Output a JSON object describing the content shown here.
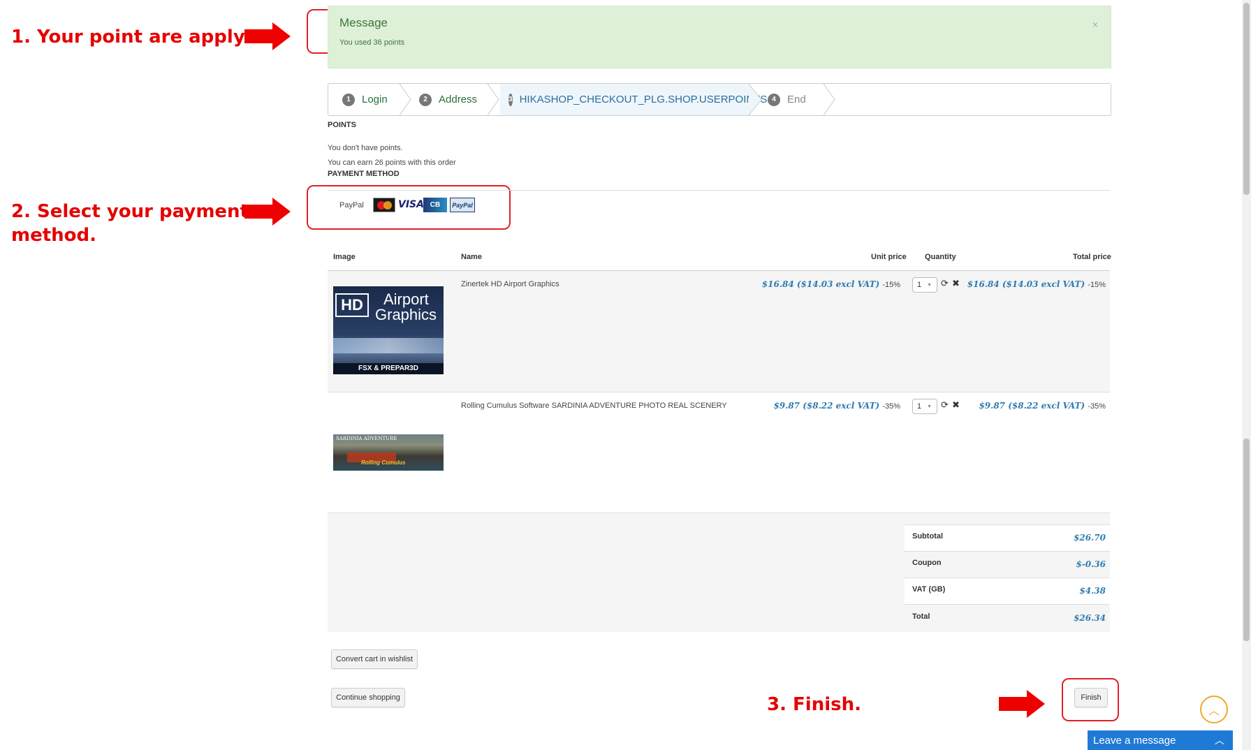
{
  "annotations": {
    "step1": "1. Your point are apply.",
    "step2_line1": "2. Select your payment",
    "step2_line2": "method.",
    "step3": "3. Finish."
  },
  "message": {
    "title": "Message",
    "text": "You used 36 points",
    "close": "×"
  },
  "steps": [
    {
      "num": "1",
      "label": "Login"
    },
    {
      "num": "2",
      "label": "Address"
    },
    {
      "num": "3",
      "label": "HIKASHOP_CHECKOUT_PLG.SHOP.USERPOINTS"
    },
    {
      "num": "4",
      "label": "End"
    }
  ],
  "points": {
    "heading": "POINTS",
    "line1": "You don't have points.",
    "line2": "You can earn 26 points with this order"
  },
  "payment": {
    "heading": "PAYMENT METHOD",
    "method_name": "PayPal",
    "card_icons": [
      "mastercard-icon",
      "visa-icon",
      "cb-icon",
      "paypal-icon"
    ],
    "visa_text": "VISA",
    "cb_text": "CB",
    "paypal_text": "PayPal"
  },
  "cart": {
    "headers": {
      "image": "Image",
      "name": "Name",
      "unit_price": "Unit price",
      "quantity": "Quantity",
      "total_price": "Total price"
    },
    "items": [
      {
        "name": "Zinertek HD Airport Graphics",
        "image_hd": "HD",
        "image_line1": "Airport",
        "image_line2": "Graphics",
        "image_footer": "FSX & PREPAR3D",
        "unit_price": "$16.84 ($14.03 excl VAT)",
        "unit_discount": "-15%",
        "quantity": "1",
        "total_price": "$16.84 ($14.03 excl VAT)",
        "total_discount": "-15%"
      },
      {
        "name": "Rolling Cumulus Software SARDINIA ADVENTURE PHOTO REAL SCENERY",
        "image_title": "SARDINIA ADVENTURE",
        "image_footer": "Rolling Cumulus",
        "unit_price": "$9.87 ($8.22 excl VAT)",
        "unit_discount": "-35%",
        "quantity": "1",
        "total_price": "$9.87 ($8.22 excl VAT)",
        "total_discount": "-35%"
      }
    ]
  },
  "summary": {
    "subtotal_label": "Subtotal",
    "subtotal": "$26.70",
    "coupon_label": "Coupon",
    "coupon": "$-0.36",
    "vat_label": "VAT (GB)",
    "vat": "$4.38",
    "total_label": "Total",
    "total": "$26.34"
  },
  "buttons": {
    "wishlist": "Convert cart in wishlist",
    "continue": "Continue shopping",
    "finish": "Finish"
  },
  "livechat": {
    "label": "Leave a message"
  },
  "colors": {
    "annotation_red": "#e60000",
    "message_bg": "#dff0d8",
    "price_blue": "#2e7bb0",
    "chat_blue": "#1f7ad6"
  }
}
